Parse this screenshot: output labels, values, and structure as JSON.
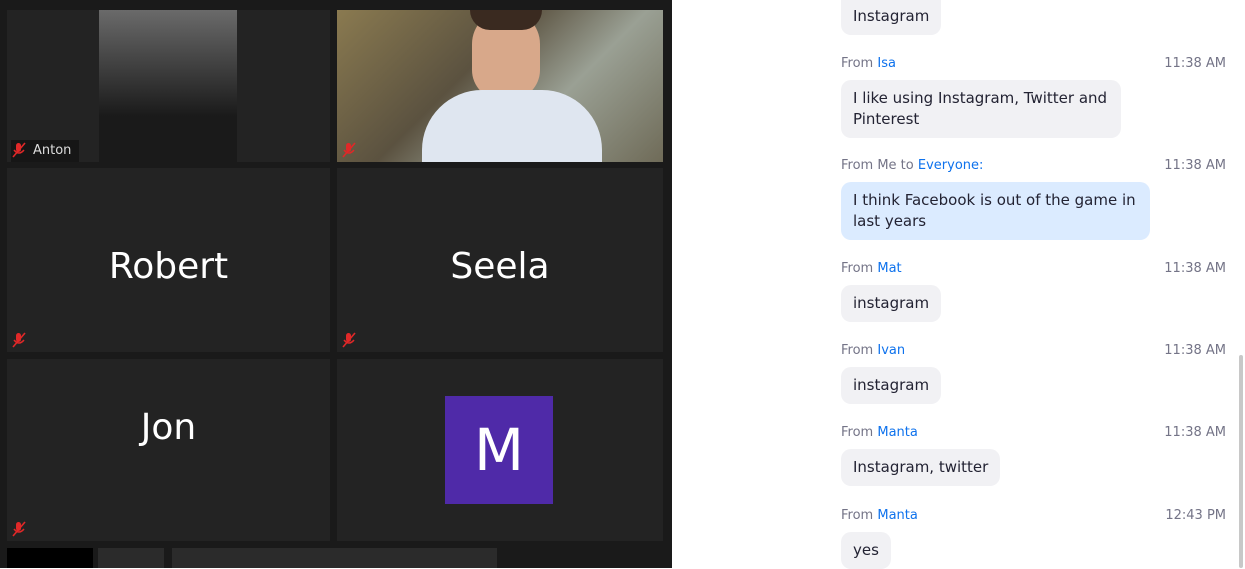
{
  "participants": [
    {
      "name": "Anton"
    },
    {
      "name": ""
    },
    {
      "name": "Robert"
    },
    {
      "name": "Seela"
    },
    {
      "name": "Jon"
    },
    {
      "name": "",
      "avatar_letter": "M"
    }
  ],
  "chat": {
    "messages": [
      {
        "from_label": "",
        "from": "",
        "time": "",
        "text": "Instagram"
      },
      {
        "from_label": "From",
        "from": "Isa",
        "time": "11:38 AM",
        "text": "I like using Instagram, Twitter and Pinterest"
      },
      {
        "from_label": "From Me to",
        "from": "Everyone:",
        "time": "11:38 AM",
        "text": "I think Facebook is out of the game in last years"
      },
      {
        "from_label": "From",
        "from": "Mat",
        "time": "11:38 AM",
        "text": "instagram"
      },
      {
        "from_label": "From",
        "from": "Ivan",
        "time": "11:38 AM",
        "text": "instagram"
      },
      {
        "from_label": "From",
        "from": "Manta",
        "time": "11:38 AM",
        "text": "Instagram, twitter"
      },
      {
        "from_label": "From",
        "from": "Manta",
        "time": "12:43 PM",
        "text": "yes"
      }
    ]
  },
  "colors": {
    "accent": "#0e72ed",
    "avatar": "#4f2aa8",
    "mute": "#e02828"
  }
}
